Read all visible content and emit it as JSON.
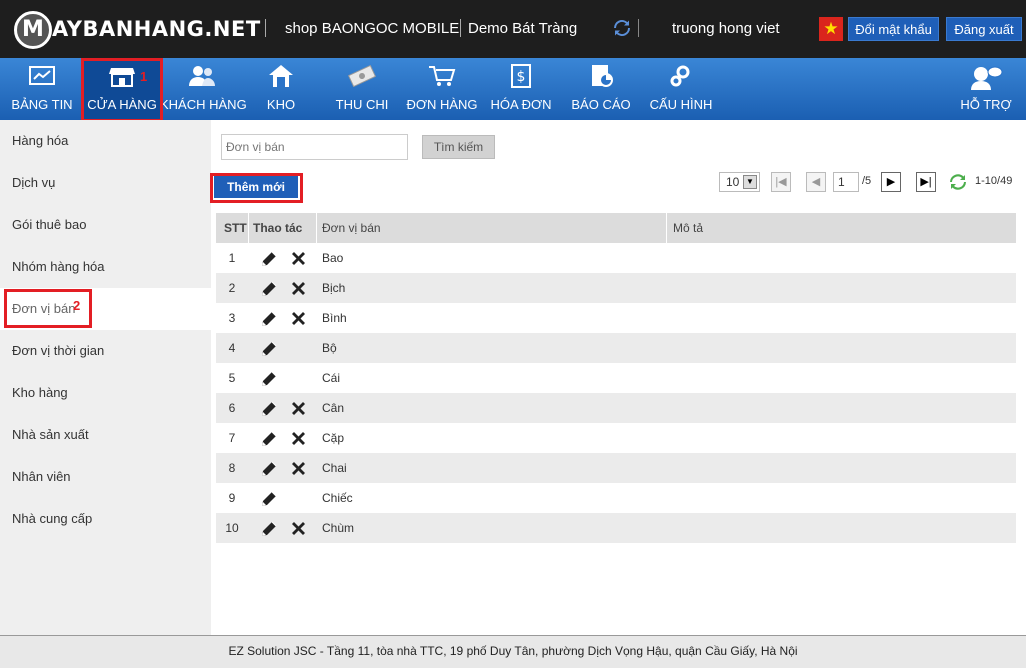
{
  "topbar": {
    "logo": "AYBANHANG.NET",
    "logo_mark": "M",
    "shop_name": "shop BAONGOC MOBILE",
    "store": "Demo Bát Tràng",
    "user": "truong hong viet",
    "change_password": "Đổi mật khẩu",
    "logout": "Đăng xuất"
  },
  "nav": {
    "items": [
      {
        "label": "BẢNG TIN",
        "icon": "dashboard-icon"
      },
      {
        "label": "CỬA HÀNG",
        "icon": "store-icon"
      },
      {
        "label": "KHÁCH HÀNG",
        "icon": "customers-icon"
      },
      {
        "label": "KHO",
        "icon": "warehouse-icon"
      },
      {
        "label": "THU CHI",
        "icon": "money-icon"
      },
      {
        "label": "ĐƠN HÀNG",
        "icon": "cart-icon"
      },
      {
        "label": "HÓA ĐƠN",
        "icon": "invoice-icon"
      },
      {
        "label": "BÁO CÁO",
        "icon": "report-icon"
      },
      {
        "label": "CẤU HÌNH",
        "icon": "settings-icon"
      },
      {
        "label": "HỖ TRỢ",
        "icon": "support-icon"
      }
    ],
    "marker1": "1",
    "marker2": "2"
  },
  "sidebar": {
    "items": [
      {
        "label": "Hàng hóa"
      },
      {
        "label": "Dịch vụ"
      },
      {
        "label": "Gói thuê bao"
      },
      {
        "label": "Nhóm hàng hóa"
      },
      {
        "label": "Đơn vị bán"
      },
      {
        "label": "Đơn vị thời gian"
      },
      {
        "label": "Kho hàng"
      },
      {
        "label": "Nhà sản xuất"
      },
      {
        "label": "Nhân viên"
      },
      {
        "label": "Nhà cung cấp"
      }
    ]
  },
  "search": {
    "placeholder": "Đơn vị bán",
    "button": "Tìm kiếm"
  },
  "add_button": "Thêm mới",
  "pager": {
    "page_size": "10",
    "page": "1",
    "total_pages": "/5",
    "summary": "1-10/49"
  },
  "grid": {
    "columns": [
      "STT",
      "Thao tác",
      "Đơn vị bán",
      "Mô tả"
    ],
    "rows": [
      {
        "stt": "1",
        "name": "Bao",
        "deletable": true
      },
      {
        "stt": "2",
        "name": "Bịch",
        "deletable": true
      },
      {
        "stt": "3",
        "name": "Bình",
        "deletable": true
      },
      {
        "stt": "4",
        "name": "Bộ",
        "deletable": false
      },
      {
        "stt": "5",
        "name": "Cái",
        "deletable": false
      },
      {
        "stt": "6",
        "name": "Cân",
        "deletable": true
      },
      {
        "stt": "7",
        "name": "Cặp",
        "deletable": true
      },
      {
        "stt": "8",
        "name": "Chai",
        "deletable": true
      },
      {
        "stt": "9",
        "name": "Chiếc",
        "deletable": false
      },
      {
        "stt": "10",
        "name": "Chùm",
        "deletable": true
      }
    ]
  },
  "footer": "EZ Solution JSC - Tầng 11, tòa nhà TTC, 19 phố Duy Tân, phường Dịch Vọng Hậu, quận Cầu Giấy, Hà Nội",
  "colors": {
    "accent": "#1f5fb8",
    "nav": "#2a73c8",
    "highlight": "#e31e24",
    "topbar": "#1e1e1e"
  }
}
